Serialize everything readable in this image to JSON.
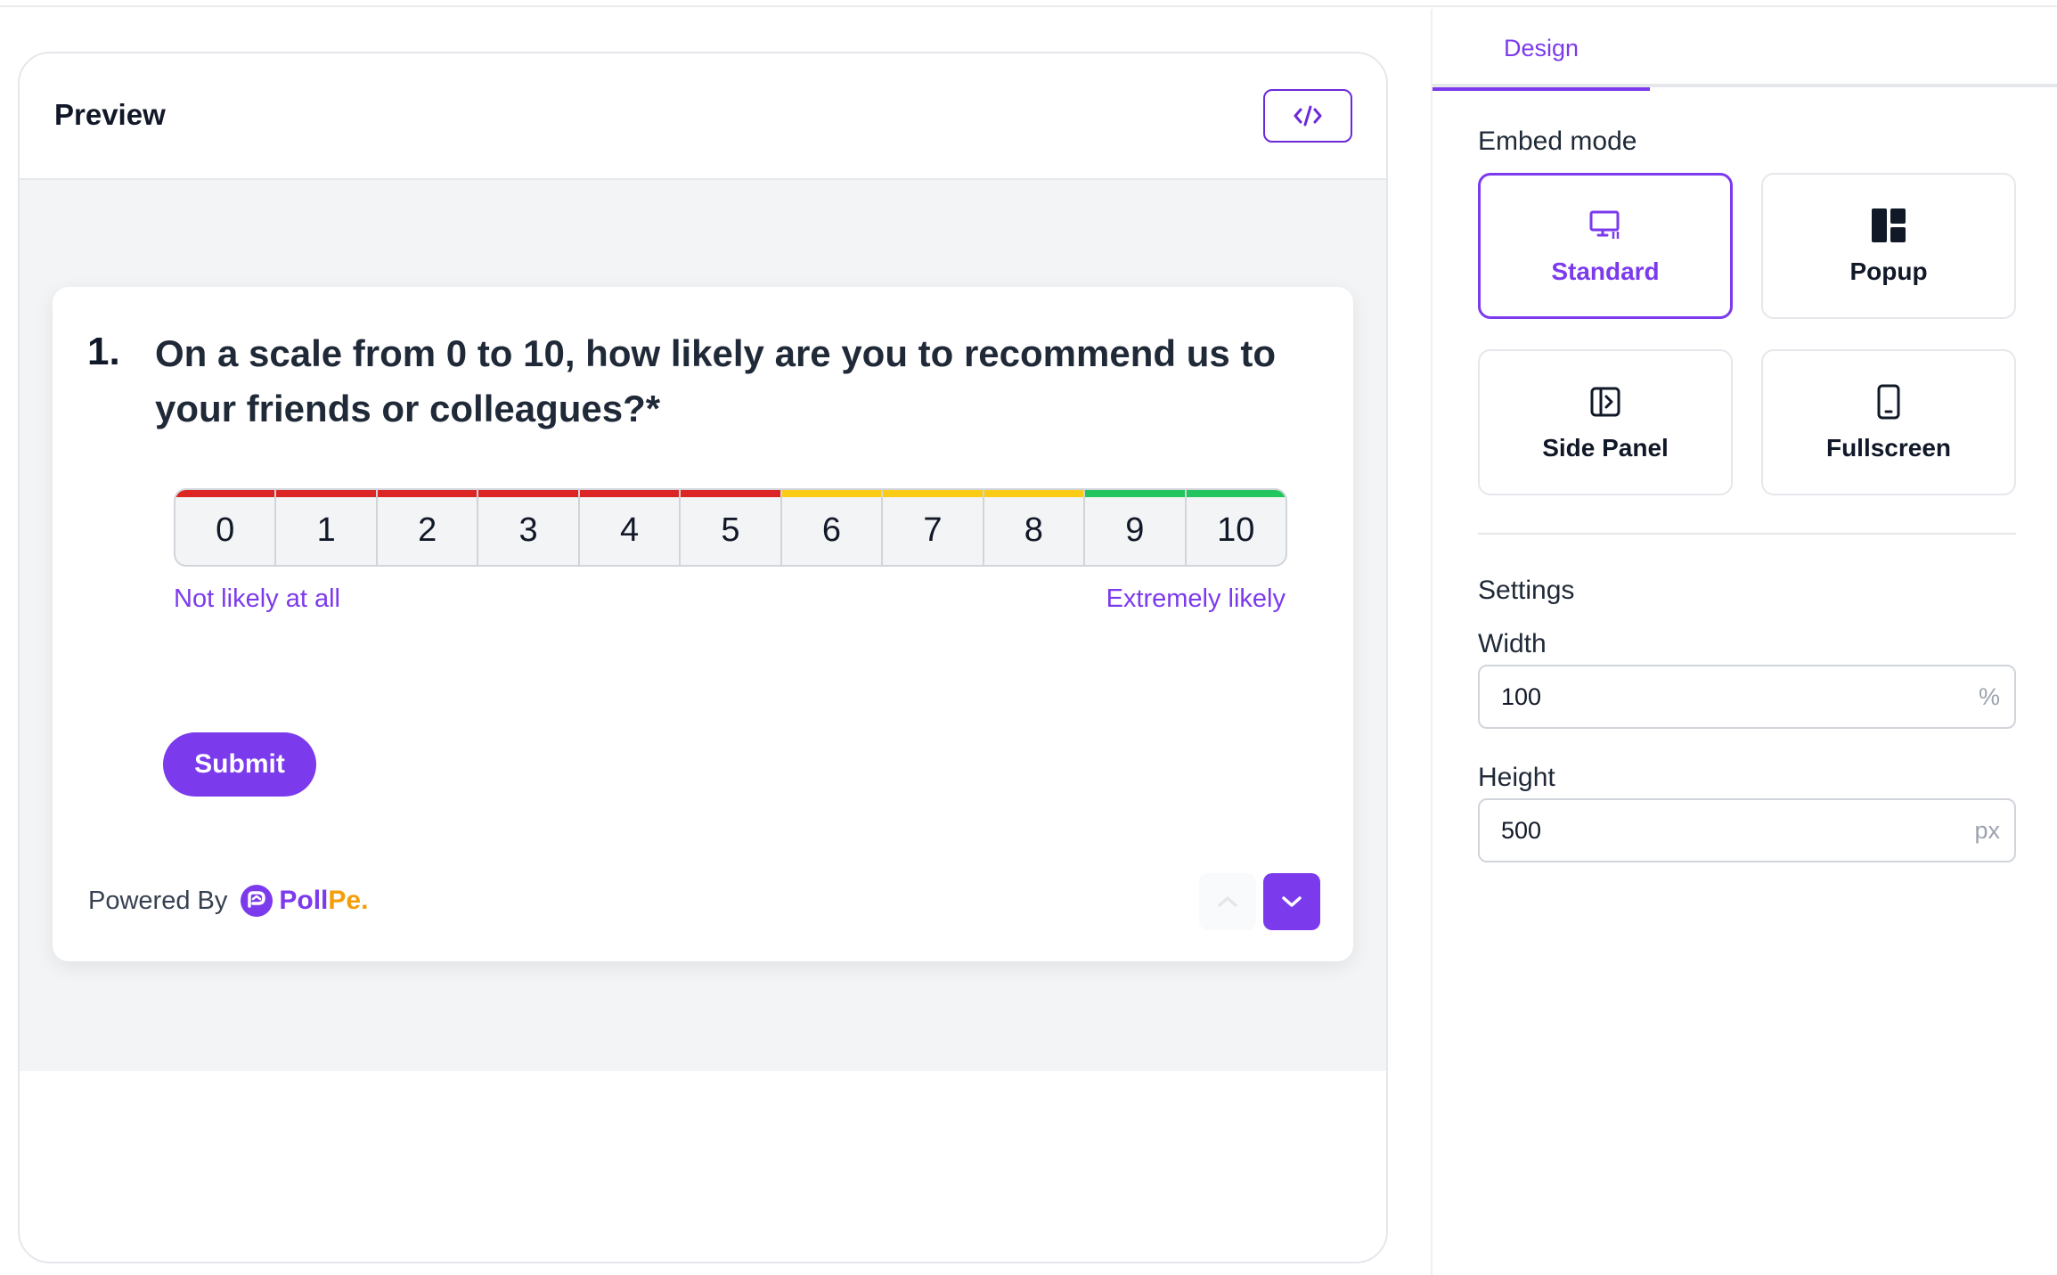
{
  "preview": {
    "title": "Preview",
    "code_icon": "code-icon"
  },
  "question": {
    "number": "1.",
    "text": "On a scale from 0 to 10, how likely are you to recommend us to your friends or colleagues?*",
    "scale": [
      {
        "label": "0",
        "color": "#dc2626"
      },
      {
        "label": "1",
        "color": "#dc2626"
      },
      {
        "label": "2",
        "color": "#dc2626"
      },
      {
        "label": "3",
        "color": "#dc2626"
      },
      {
        "label": "4",
        "color": "#dc2626"
      },
      {
        "label": "5",
        "color": "#dc2626"
      },
      {
        "label": "6",
        "color": "#facc15"
      },
      {
        "label": "7",
        "color": "#facc15"
      },
      {
        "label": "8",
        "color": "#facc15"
      },
      {
        "label": "9",
        "color": "#22c55e"
      },
      {
        "label": "10",
        "color": "#22c55e"
      }
    ],
    "low_label": "Not likely at all",
    "high_label": "Extremely likely",
    "submit_label": "Submit"
  },
  "footer": {
    "powered_by": "Powered By",
    "brand_poll": "Poll",
    "brand_pe": "Pe."
  },
  "side": {
    "tab_design": "Design",
    "embed_mode_label": "Embed mode",
    "modes": {
      "standard": "Standard",
      "popup": "Popup",
      "side_panel": "Side Panel",
      "fullscreen": "Fullscreen"
    },
    "selected_mode": "Standard",
    "settings_label": "Settings",
    "width_label": "Width",
    "width_value": "100",
    "width_unit": "%",
    "height_label": "Height",
    "height_value": "500",
    "height_unit": "px"
  },
  "colors": {
    "accent": "#7c3aed",
    "brand_orange": "#f59e0b"
  }
}
